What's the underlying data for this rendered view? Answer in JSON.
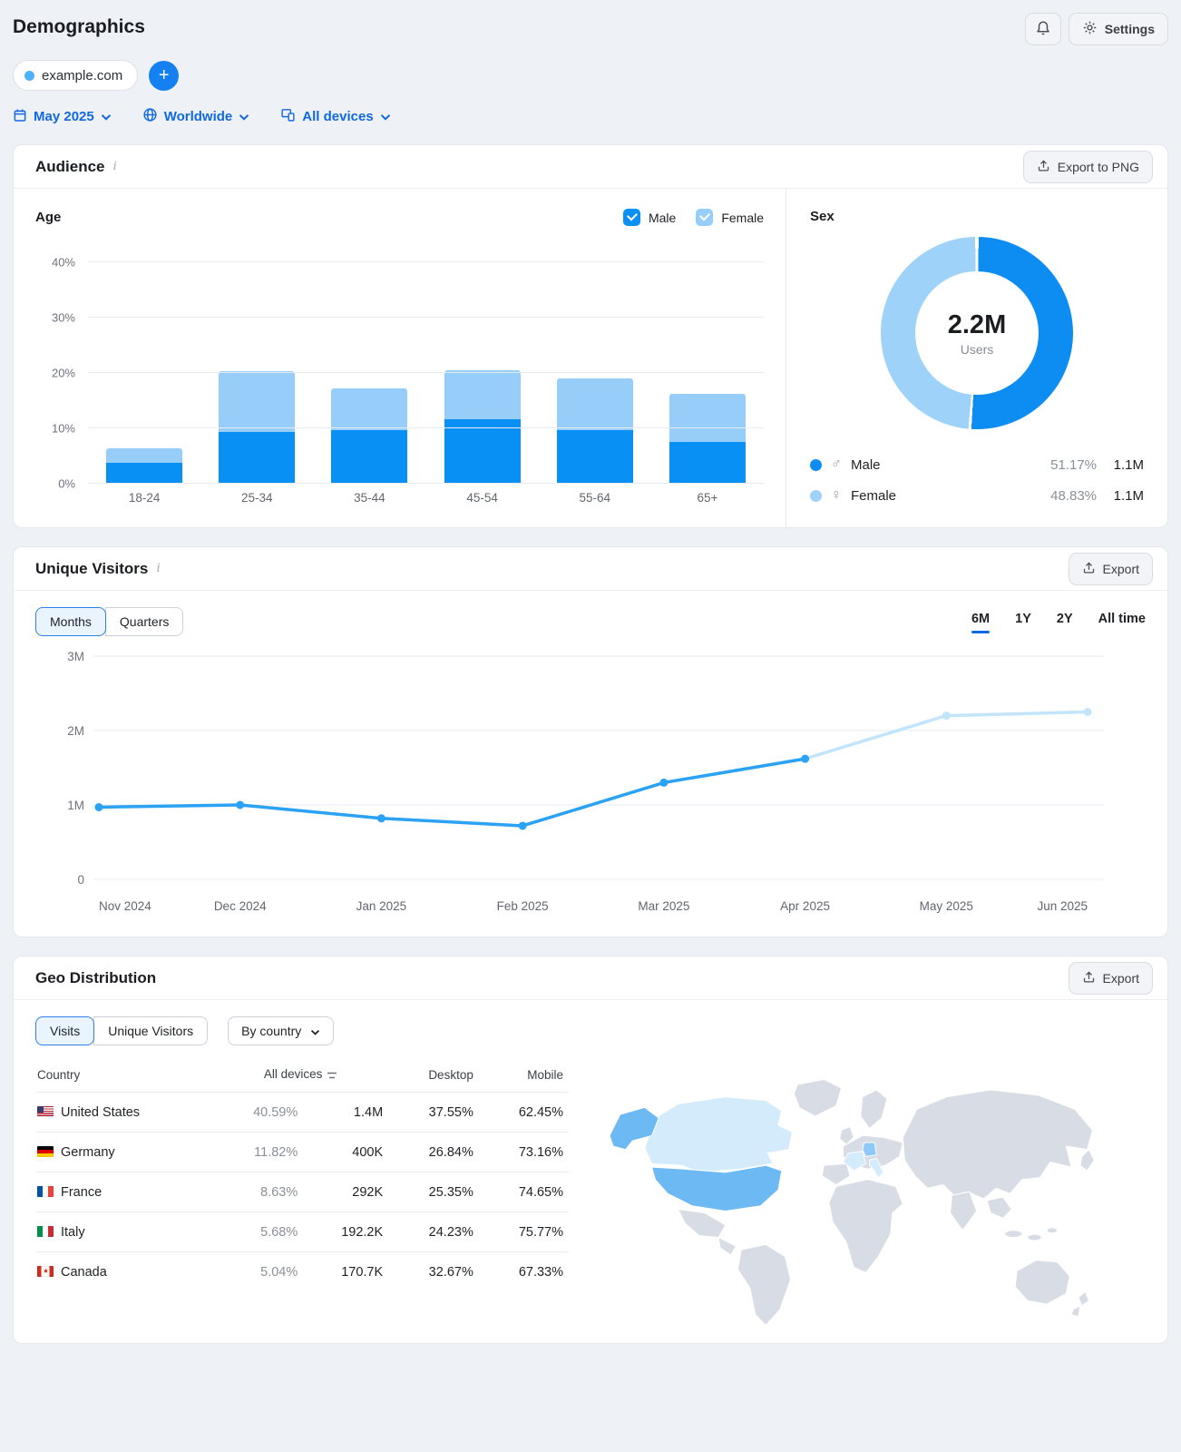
{
  "page": {
    "title": "Demographics"
  },
  "topbar": {
    "settings_label": "Settings"
  },
  "project": {
    "domain": "example.com"
  },
  "filters": {
    "date_label": "May 2025",
    "region_label": "Worldwide",
    "device_label": "All devices"
  },
  "audience": {
    "title": "Audience",
    "export_label": "Export to PNG",
    "age_title": "Age",
    "male_label": "Male",
    "female_label": "Female",
    "sex_title": "Sex",
    "legend": [
      {
        "name": "Male",
        "symbol": "♂",
        "pct_label": "51.17%",
        "value": "1.1M"
      },
      {
        "name": "Female",
        "symbol": "♀",
        "pct_label": "48.83%",
        "value": "1.1M"
      }
    ]
  },
  "visitors": {
    "title": "Unique Visitors",
    "export_label": "Export",
    "toggle": [
      "Months",
      "Quarters"
    ],
    "toggle_selected": "Months",
    "ranges": [
      "6M",
      "1Y",
      "2Y",
      "All time"
    ],
    "range_selected": "6M"
  },
  "geo": {
    "title": "Geo Distribution",
    "export_label": "Export",
    "toggle": [
      "Visits",
      "Unique Visitors"
    ],
    "toggle_selected": "Visits",
    "dropdown_label": "By country",
    "table": {
      "headers": {
        "country": "Country",
        "all_devices": "All devices",
        "desktop": "Desktop",
        "mobile": "Mobile"
      },
      "rows": [
        {
          "country": "United States",
          "code": "us",
          "share": "40.59%",
          "visits": "1.4M",
          "desktop": "37.55%",
          "mobile": "62.45%"
        },
        {
          "country": "Germany",
          "code": "de",
          "share": "11.82%",
          "visits": "400K",
          "desktop": "26.84%",
          "mobile": "73.16%"
        },
        {
          "country": "France",
          "code": "fr",
          "share": "8.63%",
          "visits": "292K",
          "desktop": "25.35%",
          "mobile": "74.65%"
        },
        {
          "country": "Italy",
          "code": "it",
          "share": "5.68%",
          "visits": "192.2K",
          "desktop": "24.23%",
          "mobile": "75.77%"
        },
        {
          "country": "Canada",
          "code": "ca",
          "share": "5.04%",
          "visits": "170.7K",
          "desktop": "32.67%",
          "mobile": "67.33%"
        }
      ]
    },
    "map_highlighted": [
      "United States",
      "Canada",
      "Germany",
      "France",
      "Italy"
    ]
  },
  "chart_data": [
    {
      "type": "bar",
      "title": "Age",
      "stacked": true,
      "categories": [
        "18-24",
        "25-34",
        "35-44",
        "45-54",
        "55-64",
        "65+"
      ],
      "series": [
        {
          "name": "Male",
          "color": "#0990f4",
          "values": [
            3.7,
            9.3,
            9.6,
            11.6,
            9.6,
            7.5
          ]
        },
        {
          "name": "Female",
          "color": "#96cdf9",
          "values": [
            2.7,
            11.0,
            7.6,
            8.9,
            9.4,
            8.7
          ]
        }
      ],
      "unit": "%",
      "ylim": [
        0,
        40
      ],
      "yticks": [
        0,
        10,
        20,
        30,
        40
      ],
      "ytick_labels": [
        "0%",
        "10%",
        "20%",
        "30%",
        "40%"
      ]
    },
    {
      "type": "pie",
      "title": "Sex",
      "center_value": "2.2M",
      "center_label": "Users",
      "slices": [
        {
          "name": "Male",
          "pct": 51.17,
          "value": "1.1M",
          "color": "#0d8df2"
        },
        {
          "name": "Female",
          "pct": 48.83,
          "value": "1.1M",
          "color": "#9ed2f9"
        }
      ]
    },
    {
      "type": "line",
      "title": "Unique Visitors",
      "x": [
        "Nov 2024",
        "Dec 2024",
        "Jan 2025",
        "Feb 2025",
        "Mar 2025",
        "Apr 2025",
        "May 2025",
        "Jun 2025"
      ],
      "values_millions": [
        0.97,
        1.0,
        0.82,
        0.72,
        1.3,
        1.62,
        2.2,
        2.25
      ],
      "forecast_start_index": 6,
      "ylim": [
        0,
        3
      ],
      "ytick_labels": [
        "0",
        "1M",
        "2M",
        "3M"
      ],
      "line_color": "#2ba2f3",
      "forecast_color": "#c3e5fb",
      "grid": true,
      "legend_position": "none"
    }
  ]
}
